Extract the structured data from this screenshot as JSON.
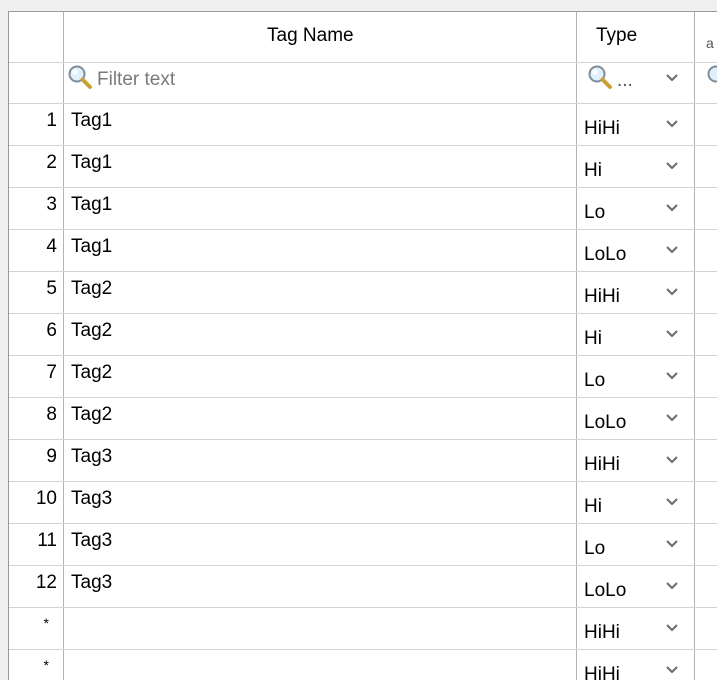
{
  "columns": {
    "tag_name": "Tag Name",
    "type": "Type"
  },
  "filter": {
    "tag_name_placeholder": "Filter text",
    "type_value": "..."
  },
  "rows": [
    {
      "num": "1",
      "tag": "Tag1",
      "type": "HiHi"
    },
    {
      "num": "2",
      "tag": "Tag1",
      "type": "Hi"
    },
    {
      "num": "3",
      "tag": "Tag1",
      "type": "Lo"
    },
    {
      "num": "4",
      "tag": "Tag1",
      "type": "LoLo"
    },
    {
      "num": "5",
      "tag": "Tag2",
      "type": "HiHi"
    },
    {
      "num": "6",
      "tag": "Tag2",
      "type": "Hi"
    },
    {
      "num": "7",
      "tag": "Tag2",
      "type": "Lo"
    },
    {
      "num": "8",
      "tag": "Tag2",
      "type": "LoLo"
    },
    {
      "num": "9",
      "tag": "Tag3",
      "type": "HiHi"
    },
    {
      "num": "10",
      "tag": "Tag3",
      "type": "Hi"
    },
    {
      "num": "11",
      "tag": "Tag3",
      "type": "Lo"
    },
    {
      "num": "12",
      "tag": "Tag3",
      "type": "LoLo"
    },
    {
      "num": "*",
      "tag": "",
      "type": "HiHi"
    },
    {
      "num": "*",
      "tag": "",
      "type": "HiHi"
    }
  ],
  "icons": {
    "filter": "magnifier-icon",
    "dropdown": "chevron-down-icon"
  },
  "colors": {
    "grid_line": "#d3d3d3",
    "dropdown_bg": "#e8e8e8",
    "placeholder": "#7a7a7a",
    "chevron": "#6a6a6a"
  }
}
